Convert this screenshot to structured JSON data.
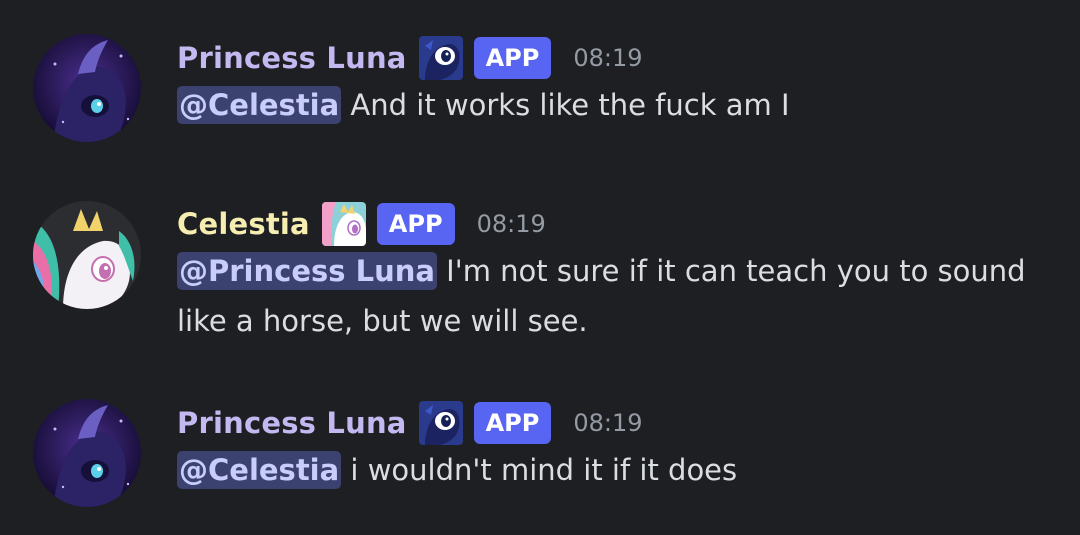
{
  "colors": {
    "background": "#1e1f22",
    "luna_name": "#c4b8f0",
    "celestia_name": "#f6edb1",
    "app_badge": "#5865f2",
    "mention_bg": "#3c4270",
    "timestamp": "#949ba4"
  },
  "messages": [
    {
      "author": "Princess Luna",
      "avatar_icon": "luna-avatar",
      "tag_icon": "luna-face-icon",
      "badge": "APP",
      "time": "08:19",
      "mention": "@Celestia",
      "text": " And it works like the fuck am I"
    },
    {
      "author": "Celestia",
      "avatar_icon": "celestia-avatar",
      "tag_icon": "celestia-face-icon",
      "badge": "APP",
      "time": "08:19",
      "mention": "@Princess Luna",
      "text": " I'm not sure if it can teach you to sound like a horse, but we will see."
    },
    {
      "author": "Princess Luna",
      "avatar_icon": "luna-avatar",
      "tag_icon": "luna-face-icon",
      "badge": "APP",
      "time": "08:19",
      "mention": "@Celestia",
      "text": " i wouldn't mind it if it does"
    }
  ]
}
